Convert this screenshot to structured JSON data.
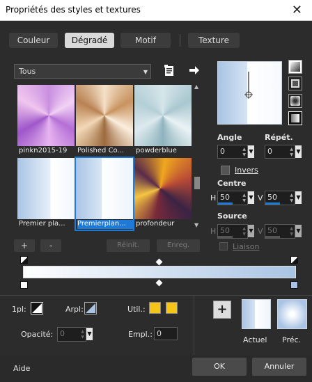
{
  "window": {
    "title": "Propriétés des styles et textures",
    "close_glyph": "✕"
  },
  "tabs": [
    {
      "label": "Couleur",
      "active": false
    },
    {
      "label": "Dégradé",
      "active": true
    },
    {
      "label": "Motif",
      "active": false
    },
    {
      "label": "Texture",
      "active": false
    }
  ],
  "category": {
    "value": "Tous"
  },
  "thumbnails": [
    {
      "caption": "pinkn2015-19",
      "selected": false
    },
    {
      "caption": "Polished Co...",
      "selected": false
    },
    {
      "caption": "powderblue",
      "selected": false
    },
    {
      "caption": "Premier pla...",
      "selected": false
    },
    {
      "caption": "Premierplan...",
      "selected": true
    },
    {
      "caption": "profondeur",
      "selected": false
    }
  ],
  "list_buttons": {
    "add": "+",
    "remove": "-",
    "reset": "Réinit.",
    "save": "Enreg."
  },
  "angle": {
    "label": "Angle",
    "value": "0"
  },
  "repeat": {
    "label": "Répét.",
    "value": "0"
  },
  "invert": {
    "label": "Invers"
  },
  "center": {
    "label": "Centre",
    "h_label": "H",
    "h_value": "50",
    "v_label": "V",
    "v_value": "50"
  },
  "source": {
    "label": "Source",
    "h_label": "H",
    "h_value": "50",
    "v_label": "V",
    "v_value": "50"
  },
  "link": {
    "label": "Liaison"
  },
  "bottom": {
    "fg_label": "1pl:",
    "bg_label": "Arpl:",
    "user_label": "Util.:",
    "opacity_label": "Opacité:",
    "opacity_value": "0",
    "location_label": "Empl.:",
    "location_value": "0",
    "add_label": "+",
    "current_label": "Actuel",
    "previous_label": "Préc."
  },
  "footer": {
    "help": "Aide",
    "ok": "OK",
    "cancel": "Annuler"
  },
  "colors": {
    "accent": "#1e7ad6",
    "gradient_start": "#ffffff",
    "gradient_end": "#a9c4e4",
    "user_swatch": "#f5c518"
  },
  "icons": [
    "close-icon",
    "save-preset-icon",
    "arrow-right-icon",
    "linear-style-icon",
    "rectangular-style-icon",
    "sunburst-style-icon",
    "radial-style-icon",
    "stop-marker-icon"
  ]
}
